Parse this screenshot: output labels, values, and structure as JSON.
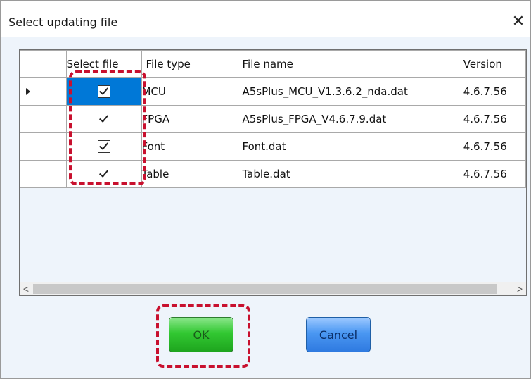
{
  "dialog": {
    "title": "Select updating file",
    "close_glyph": "✕"
  },
  "grid": {
    "columns": [
      "",
      "Select file",
      "File type",
      "File name",
      "Version"
    ],
    "rows": [
      {
        "selected": true,
        "checked": true,
        "type": "MCU",
        "name": "A5sPlus_MCU_V1.3.6.2_nda.dat",
        "version": "4.6.7.56"
      },
      {
        "selected": false,
        "checked": true,
        "type": "FPGA",
        "name": "A5sPlus_FPGA_V4.6.7.9.dat",
        "version": "4.6.7.56"
      },
      {
        "selected": false,
        "checked": true,
        "type": "Font",
        "name": "Font.dat",
        "version": "4.6.7.56"
      },
      {
        "selected": false,
        "checked": true,
        "type": "Table",
        "name": "Table.dat",
        "version": "4.6.7.56"
      }
    ],
    "scroll_left_glyph": "<",
    "scroll_right_glyph": ">"
  },
  "buttons": {
    "ok_label": "OK",
    "cancel_label": "Cancel"
  },
  "colors": {
    "selection": "#0078d7",
    "highlight": "#c8102e",
    "ok_green": "#32c832",
    "cancel_blue": "#4a97f2"
  }
}
